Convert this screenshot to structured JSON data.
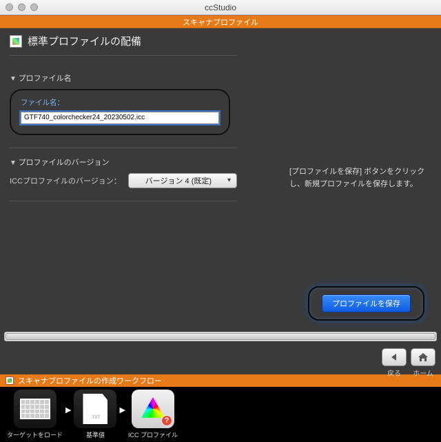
{
  "app_title": "ccStudio",
  "banner": "スキャナプロファイル",
  "heading": "標準プロファイルの配備",
  "sections": {
    "profile_name": {
      "title": "プロファイル名",
      "field_label": "ファイル名：",
      "value": "GTF740_colorchecker24_20230502.icc"
    },
    "profile_version": {
      "title": "プロファイルのバージョン",
      "label": "ICCプロファイルのバージョン：",
      "selected": "バージョン 4 (既定)"
    }
  },
  "hint": "[プロファイルを保存] ボタンをクリックし、新規プロファイルを保存します。",
  "save_button": "プロファイルを保存",
  "nav": {
    "back": "戻る",
    "home": "ホーム"
  },
  "workflow": {
    "title": "スキャナプロファイルの作成ワークフロー",
    "steps": [
      "ターゲットをロード",
      "基準値",
      "ICC プロファイル"
    ],
    "doc_badge": ".TXT"
  }
}
